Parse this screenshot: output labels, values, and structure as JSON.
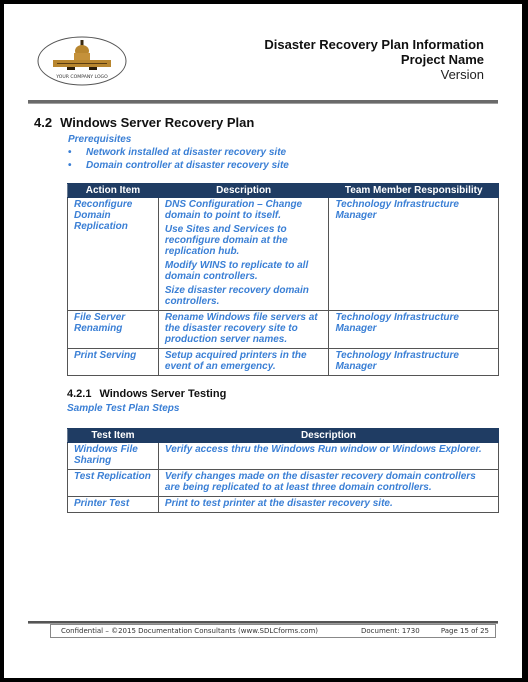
{
  "header": {
    "logo_text": "YOUR COMPANY LOGO",
    "title": "Disaster Recovery Plan Information",
    "project": "Project Name",
    "version": "Version"
  },
  "section": {
    "number": "4.2",
    "title": "Windows Server Recovery Plan",
    "prerequisites_title": "Prerequisites",
    "prerequisites": [
      "Network installed at disaster recovery site",
      "Domain controller at disaster recovery site"
    ],
    "table": {
      "headers": [
        "Action Item",
        "Description",
        "Team Member Responsibility"
      ],
      "rows": [
        {
          "action": "Reconfigure Domain Replication",
          "description": [
            "DNS Configuration – Change domain to point to itself.",
            "Use Sites and Services to reconfigure domain at the replication hub.",
            "Modify WINS to replicate to all domain controllers.",
            "Size disaster recovery domain controllers."
          ],
          "responsibility": "Technology Infrastructure Manager"
        },
        {
          "action": "File Server Renaming",
          "description": [
            "Rename Windows file servers at the disaster recovery site to production server names."
          ],
          "responsibility": "Technology Infrastructure Manager"
        },
        {
          "action": "Print Serving",
          "description": [
            "Setup acquired printers in the event of an emergency."
          ],
          "responsibility": "Technology Infrastructure Manager"
        }
      ]
    }
  },
  "subsection": {
    "number": "4.2.1",
    "title": "Windows Server Testing",
    "caption": "Sample Test Plan Steps",
    "table": {
      "headers": [
        "Test Item",
        "Description"
      ],
      "rows": [
        {
          "item": "Windows File Sharing",
          "description": "Verify access thru the Windows Run window or Windows Explorer."
        },
        {
          "item": "Test Replication",
          "description": "Verify changes made on the disaster recovery domain controllers are being replicated to at least three domain controllers."
        },
        {
          "item": "Printer Test",
          "description": "Print to test printer at the disaster recovery site."
        }
      ]
    }
  },
  "footer": {
    "confidential": "Confidential – ©2015 Documentation Consultants (www.SDLCforms.com)",
    "document": "Document: 1730",
    "page": "Page 15 of 25"
  },
  "colors": {
    "accent_blue": "#3a7fd5",
    "header_navy": "#1f3c63"
  }
}
